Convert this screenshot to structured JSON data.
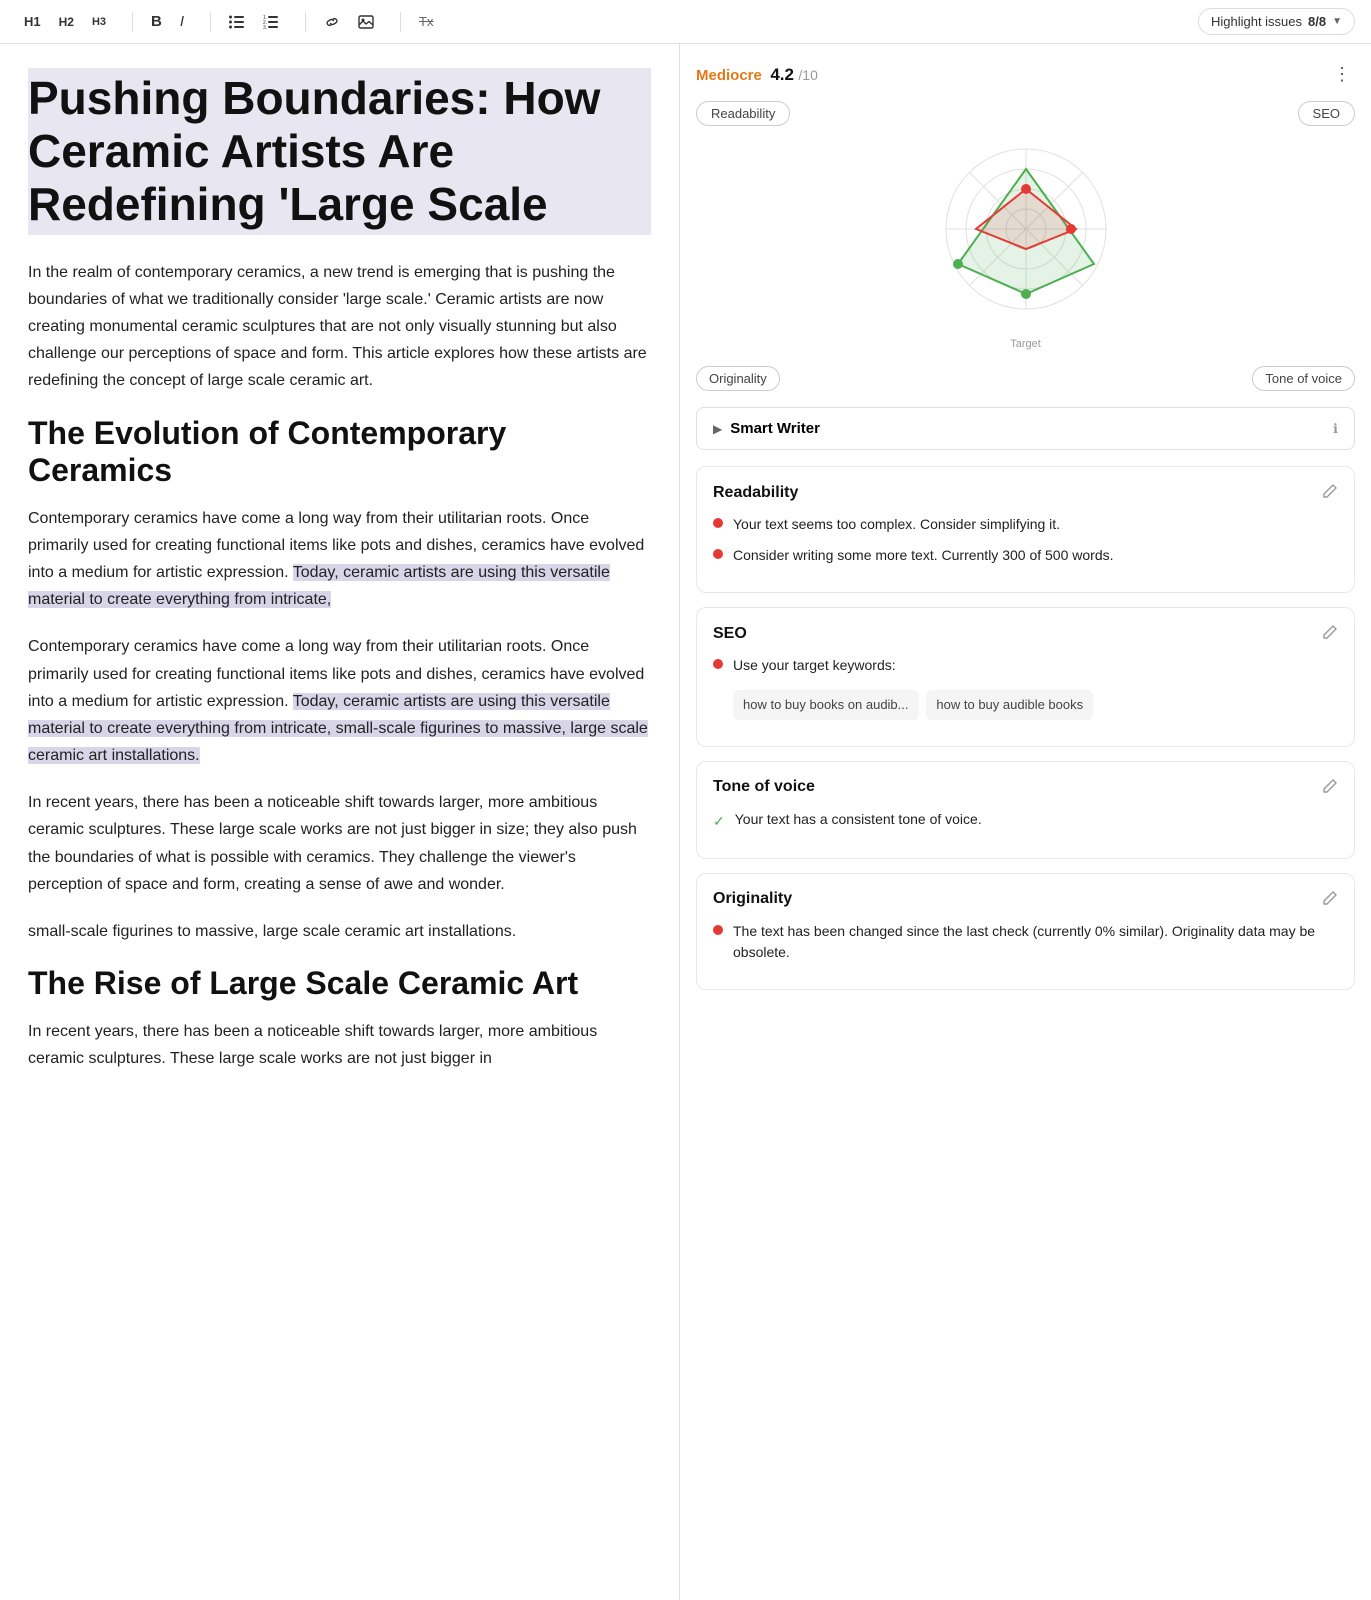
{
  "toolbar": {
    "h1_label": "H1",
    "h2_label": "H2",
    "h3_label": "H3",
    "bold_label": "B",
    "italic_label": "I",
    "ul_label": "☰",
    "ol_label": "☷",
    "link_label": "🔗",
    "image_label": "⬜",
    "clear_label": "Tx",
    "highlight_label": "Highlight issues",
    "highlight_count": "8/8",
    "menu_label": "⋮"
  },
  "editor": {
    "title": "Pushing Boundaries: How Ceramic Artists Are Redefining 'Large Scale",
    "intro": "In the realm of contemporary ceramics, a new trend is emerging that is pushing the boundaries of what we traditionally consider 'large scale.' Ceramic artists are now creating monumental ceramic sculptures that are not only visually stunning but also challenge our perceptions of space and form. This article explores how these artists are redefining the concept of large scale ceramic art.",
    "h2_1": "The Evolution of Contemporary Ceramics",
    "para1": "Contemporary ceramics have come a long way from their utilitarian roots. Once primarily used for creating functional items like pots and dishes, ceramics have evolved into a medium for artistic expression. Today, ceramic artists are using this versatile material to create everything from intricate,",
    "para2": "Contemporary ceramics have come a long way from their utilitarian roots. Once primarily used for creating functional items like pots and dishes, ceramics have evolved into a medium for artistic expression. Today, ceramic artists are using this versatile material to create everything from intricate, small-scale figurines to massive, large scale ceramic art installations.",
    "para3": "In recent years, there has been a noticeable shift towards larger, more ambitious ceramic sculptures. These large scale works are not just bigger in size; they also push the boundaries of what is possible with ceramics. They challenge the viewer's perception of space and form, creating a sense of awe and wonder.",
    "para4": "small-scale figurines to massive, large scale ceramic art installations.",
    "h2_2": "The Rise of Large Scale Ceramic Art",
    "para5": "In recent years, there has been a noticeable shift towards larger, more ambitious ceramic sculptures. These large scale works are not just bigger in"
  },
  "sidebar": {
    "score_label": "Mediocre",
    "score_value": "4.2",
    "score_denom": "/10",
    "tab_readability": "Readability",
    "tab_seo": "SEO",
    "tab_originality": "Originality",
    "tab_tone": "Tone of voice",
    "radar_target": "Target",
    "smart_writer_label": "Smart Writer",
    "smart_writer_info": "ℹ",
    "readability_title": "Readability",
    "readability_item1": "Your text seems too complex. Consider simplifying it.",
    "readability_item2": "Consider writing some more text. Currently 300 of 500 words.",
    "seo_title": "SEO",
    "seo_item1": "Use your target keywords:",
    "seo_kw1": "how to buy books on audib...",
    "seo_kw2": "how to buy audible books",
    "tone_title": "Tone of voice",
    "tone_item1": "Your text has a consistent tone of voice.",
    "originality_title": "Originality",
    "originality_item1": "The text has been changed since the last check (currently 0% similar). Originality data may be obsolete."
  }
}
